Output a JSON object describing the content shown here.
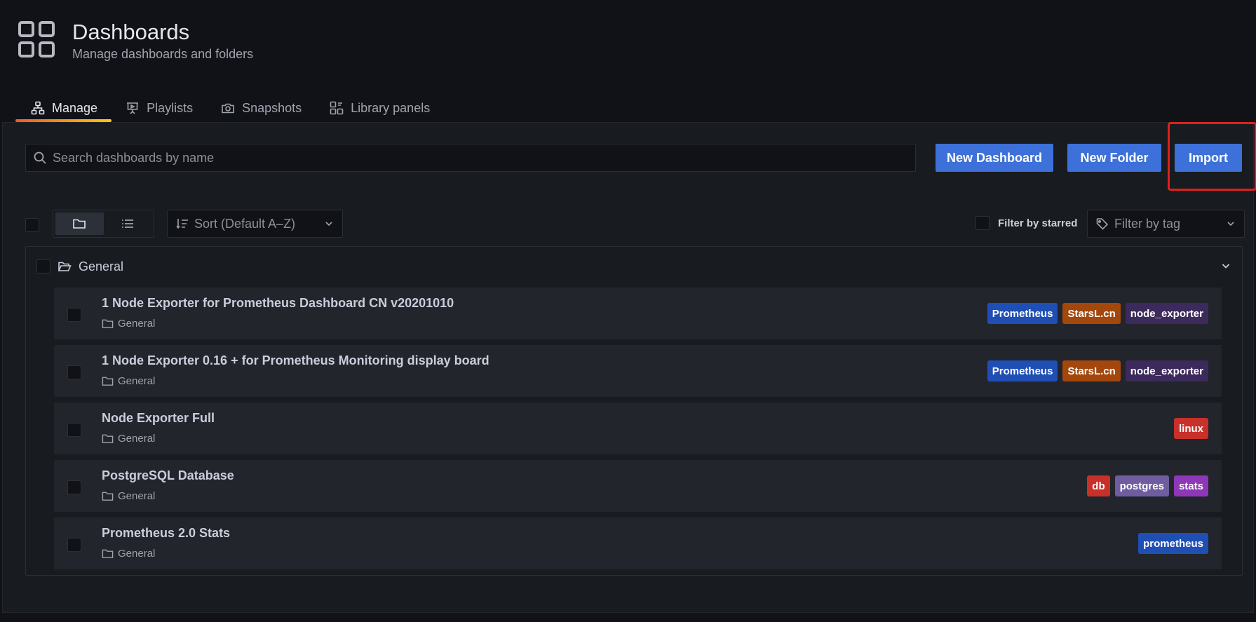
{
  "header": {
    "title": "Dashboards",
    "subtitle": "Manage dashboards and folders"
  },
  "tabs": [
    {
      "label": "Manage",
      "icon": "sitemap-icon",
      "active": true
    },
    {
      "label": "Playlists",
      "icon": "presentation-icon",
      "active": false
    },
    {
      "label": "Snapshots",
      "icon": "camera-icon",
      "active": false
    },
    {
      "label": "Library panels",
      "icon": "library-panel-icon",
      "active": false
    }
  ],
  "search": {
    "placeholder": "Search dashboards by name",
    "value": ""
  },
  "actions": {
    "new_dashboard": "New Dashboard",
    "new_folder": "New Folder",
    "import": "Import"
  },
  "toolbar": {
    "sort_label": "Sort (Default A–Z)",
    "filter_starred_label": "Filter by starred",
    "filter_tag_placeholder": "Filter by tag"
  },
  "folder": {
    "name": "General"
  },
  "dashboards": [
    {
      "title": "1 Node Exporter for Prometheus Dashboard CN v20201010",
      "location": "General",
      "tags": [
        {
          "label": "Prometheus",
          "color": "#1f4fb5"
        },
        {
          "label": "StarsL.cn",
          "color": "#a3470d"
        },
        {
          "label": "node_exporter",
          "color": "#3d2a5c"
        }
      ]
    },
    {
      "title": "1 Node Exporter 0.16 + for Prometheus Monitoring display board",
      "location": "General",
      "tags": [
        {
          "label": "Prometheus",
          "color": "#1f4fb5"
        },
        {
          "label": "StarsL.cn",
          "color": "#a3470d"
        },
        {
          "label": "node_exporter",
          "color": "#3d2a5c"
        }
      ]
    },
    {
      "title": "Node Exporter Full",
      "location": "General",
      "tags": [
        {
          "label": "linux",
          "color": "#c8302a"
        }
      ]
    },
    {
      "title": "PostgreSQL Database",
      "location": "General",
      "tags": [
        {
          "label": "db",
          "color": "#c8302a"
        },
        {
          "label": "postgres",
          "color": "#705da0"
        },
        {
          "label": "stats",
          "color": "#8e37b7"
        }
      ]
    },
    {
      "title": "Prometheus 2.0 Stats",
      "location": "General",
      "tags": [
        {
          "label": "prometheus",
          "color": "#1f4fb5"
        }
      ]
    }
  ],
  "colors": {
    "primary_button": "#3d71d9",
    "active_tab_underline": "#f05a28",
    "highlight_box": "#e0201e"
  }
}
